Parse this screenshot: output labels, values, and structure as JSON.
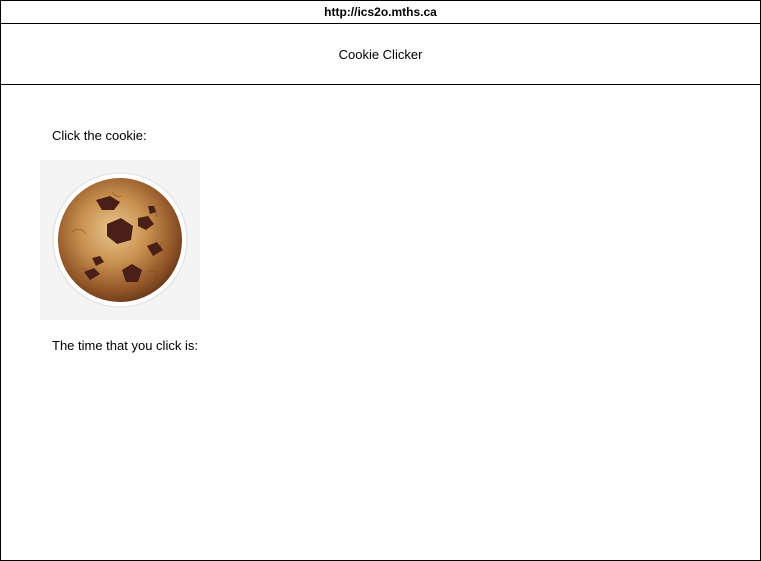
{
  "browser": {
    "url": "http://ics2o.mths.ca"
  },
  "page": {
    "title": "Cookie Clicker",
    "prompt": "Click the cookie:",
    "time_label": "The time that you click is:"
  },
  "cookie": {
    "icon": "cookie-icon"
  }
}
